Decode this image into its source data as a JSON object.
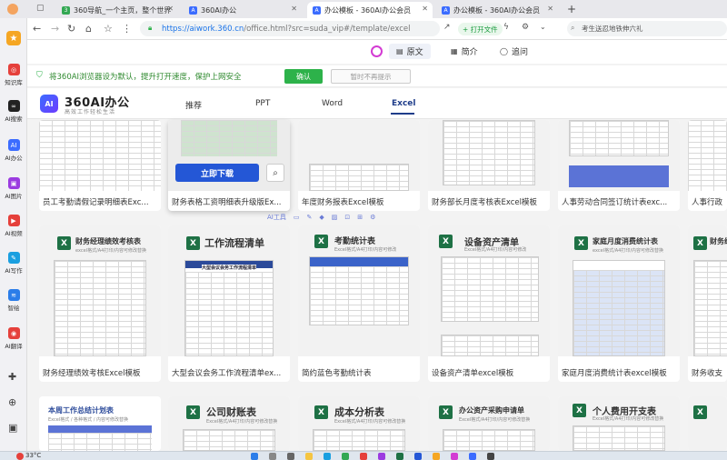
{
  "browser": {
    "tabs": [
      {
        "title": "360导航_一个主页，整个世界",
        "active": false,
        "color": "#33a853"
      },
      {
        "title": "360AI办公",
        "active": false,
        "color": "#3b6cff"
      },
      {
        "title": "办公模板 - 360AI办公会员",
        "active": true,
        "color": "#3b6cff"
      },
      {
        "title": "办公模板 - 360AI办公会员",
        "active": false,
        "color": "#3b6cff"
      }
    ],
    "new_tab": "+",
    "url_main": "https://aiwork.360.cn",
    "url_rest": "/office.html?src=suda_vip#/template/excel",
    "open_file": "+ 打开文件",
    "search_placeholder": "考生送忍地铁伸六礼"
  },
  "reader_row": {
    "original": "原文",
    "summary": "简介",
    "ask": "追问"
  },
  "sidebar": {
    "items": [
      {
        "label": "知识库",
        "color": "#e5403b"
      },
      {
        "label": "AI搜索",
        "color": "#222222"
      },
      {
        "label": "AI办公",
        "color": "#3b6cff"
      },
      {
        "label": "AI图片",
        "color": "#9b3be0"
      },
      {
        "label": "AI视频",
        "color": "#e5403b"
      },
      {
        "label": "AI写作",
        "color": "#1a9fe0"
      },
      {
        "label": "智绘",
        "color": "#2b7de9"
      },
      {
        "label": "AI翻译",
        "color": "#e5403b"
      }
    ]
  },
  "notice": {
    "text": "将360AI浏览器设为默认，提升打开速度，保护上网安全",
    "ok": "确认",
    "no": "暂时不再提示"
  },
  "app": {
    "brand": "360AI办公",
    "slogan": "高效工作轻松生活",
    "nav": [
      "推荐",
      "PPT",
      "Word",
      "Excel"
    ],
    "active_nav": "Excel"
  },
  "row1": [
    {
      "caption": "员工考勤请假记录明细表Exc..."
    },
    {
      "caption": "财务表格工资明细表升级版Ex...",
      "download": "立即下载"
    },
    {
      "caption": "年度财务报表Excel模板"
    },
    {
      "caption": "财务部长月度考核表Excel模板"
    },
    {
      "caption": "人事劳动合同签订统计表exc..."
    },
    {
      "caption": "人事行政"
    }
  ],
  "ai_toolbar": {
    "label": "AI工具"
  },
  "row2": [
    {
      "title": "财务经理绩效考核表",
      "sub": "excel格式/A4打印/内容可修改替换",
      "caption": "财务经理绩效考核Excel模板"
    },
    {
      "title": "工作流程清单",
      "sub": "",
      "caption": "大型会议会务工作流程清单ex...",
      "doc_title": "大型会议会务工作流程清单"
    },
    {
      "title": "考勤统计表",
      "sub": "Excel格式/A4打印/内容可修改",
      "caption": "简约蓝色考勤统计表"
    },
    {
      "title": "设备资产清单",
      "sub": "Excel格式/A4打印/内容可修改",
      "caption": "设备资产清单excel模板"
    },
    {
      "title": "家庭月度消费统计表",
      "sub": "excel格式/A4打印/内容可修改替换",
      "caption": "家庭月度消费统计表excel模板"
    },
    {
      "title": "财务经",
      "sub": "",
      "caption": "财务收支"
    }
  ],
  "row3": [
    {
      "title": "本周工作总结计划表",
      "sub": "Excel格式 / 各种格式 / 内容可修改替换"
    },
    {
      "title": "公司财账表",
      "sub": "Excel格式/A4打印/内容可修改替换"
    },
    {
      "title": "成本分析表",
      "sub": "Excel格式/A4打印/内容可修改替换"
    },
    {
      "title": "办公资产采购申请单",
      "sub": "Excel格式/A4打印/内容可修改替换"
    },
    {
      "title": "个人费用开支表",
      "sub": "Excel格式/A4打印/内容可修改替换"
    },
    {
      "title": "",
      "sub": ""
    }
  ],
  "taskbar": {
    "weather": "33°C"
  }
}
